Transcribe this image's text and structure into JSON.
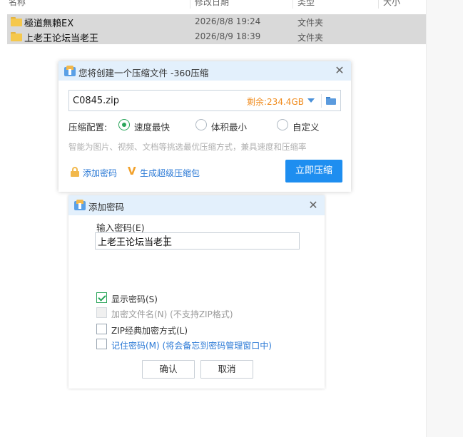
{
  "explorer": {
    "columns": [
      "名称",
      "修改日期",
      "类型",
      "大小"
    ],
    "files": [
      {
        "name": "極道無賴EX",
        "modified": "2026/8/8 19:24",
        "type": "文件夹"
      },
      {
        "name": "上老王论坛当老王",
        "modified": "2026/8/9 18:39",
        "type": "文件夹"
      }
    ]
  },
  "compress_dialog": {
    "title": "您将创建一个压缩文件 -360压缩",
    "filename": "C0845.zip",
    "free_space": "剩余:234.4GB",
    "config_label": "压缩配置:",
    "options": [
      {
        "label": "速度最快",
        "selected": true
      },
      {
        "label": "体积最小",
        "selected": false
      },
      {
        "label": "自定义",
        "selected": false
      }
    ],
    "description": "智能为图片、视频、文档等挑选最优压缩方式，兼具速度和压缩率",
    "add_password_link": "添加密码",
    "super_package_link": "生成超级压缩包",
    "compress_button": "立即压缩",
    "accent_color": "#1e8ef0"
  },
  "password_dialog": {
    "title": "添加密码",
    "input_label": "输入密码(E)",
    "password_value": "上老王论坛当老王",
    "options": [
      {
        "label": "显示密码(S)",
        "checked": true,
        "enabled": true
      },
      {
        "label": "加密文件名(N) (不支持ZIP格式)",
        "checked": false,
        "enabled": false
      },
      {
        "label": "ZIP经典加密方式(L)",
        "checked": false,
        "enabled": true
      },
      {
        "label": "记住密码(M) (将会备忘到密码管理窗口中)",
        "checked": false,
        "enabled": true
      }
    ],
    "ok_button": "确认",
    "cancel_button": "取消"
  }
}
